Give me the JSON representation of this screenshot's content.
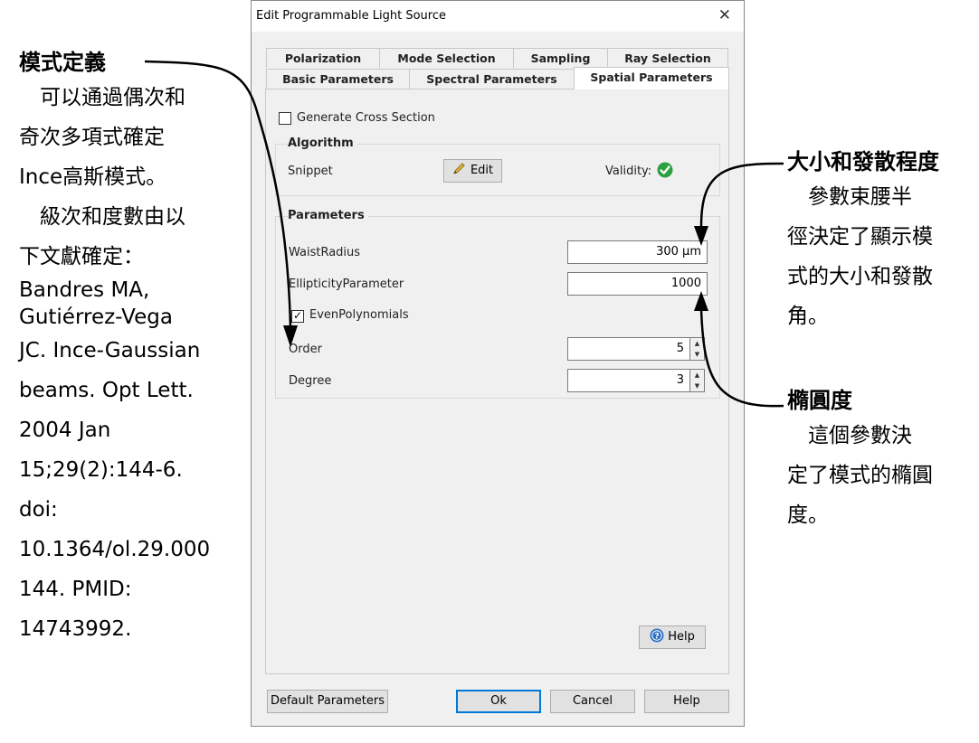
{
  "window": {
    "title": "Edit Programmable Light Source",
    "close_glyph": "✕"
  },
  "tabs_row1": [
    "Polarization",
    "Mode Selection",
    "Sampling",
    "Ray Selection"
  ],
  "tabs_row2": [
    "Basic Parameters",
    "Spectral Parameters",
    "Spatial Parameters"
  ],
  "active_tab": "Spatial Parameters",
  "generate_cross_section": {
    "label": "Generate Cross Section",
    "checked": false
  },
  "algorithm": {
    "title": "Algorithm",
    "snippet_label": "Snippet",
    "edit_label": "Edit",
    "edit_icon": "pencil-icon",
    "validity_label": "Validity:",
    "validity_icon": "check-icon",
    "validity_color": "#2ea043"
  },
  "parameters": {
    "title": "Parameters",
    "waist_label": "WaistRadius",
    "waist_value": "300 µm",
    "ellipticity_label": "EllipticityParameter",
    "ellipticity_value": "1000",
    "even_label": "EvenPolynomials",
    "even_checked": true,
    "order_label": "Order",
    "order_value": "5",
    "degree_label": "Degree",
    "degree_value": "3"
  },
  "help_button": {
    "label": "Help",
    "icon": "help-icon"
  },
  "footer": {
    "default_params": "Default Parameters",
    "ok": "Ok",
    "cancel": "Cancel",
    "help": "Help"
  },
  "colors": {
    "accent": "#0078d7",
    "dialog_bg": "#f0f0f0",
    "arrow": "#000000"
  },
  "annotations": {
    "left": {
      "heading": "模式定義",
      "lines": [
        "　可以通過偶次和",
        "奇次多項式確定",
        "Ince高斯模式。",
        "　級次和度數由以",
        "下文獻確定：",
        "Bandres MA,",
        "Gutiérrez-Vega",
        "JC. Ince-Gaussian",
        "beams. Opt Lett.",
        "2004 Jan",
        "15;29(2):144-6.",
        "doi:",
        "10.1364/ol.29.000",
        "144. PMID:",
        "14743992."
      ]
    },
    "right_top": {
      "heading": "大小和發散程度",
      "lines": [
        "　參數束腰半",
        "徑決定了顯示模",
        "式的大小和發散",
        "角。"
      ]
    },
    "right_bottom": {
      "heading": "橢圓度",
      "lines": [
        "　這個參數決",
        "定了模式的橢圓",
        "度。"
      ]
    }
  }
}
